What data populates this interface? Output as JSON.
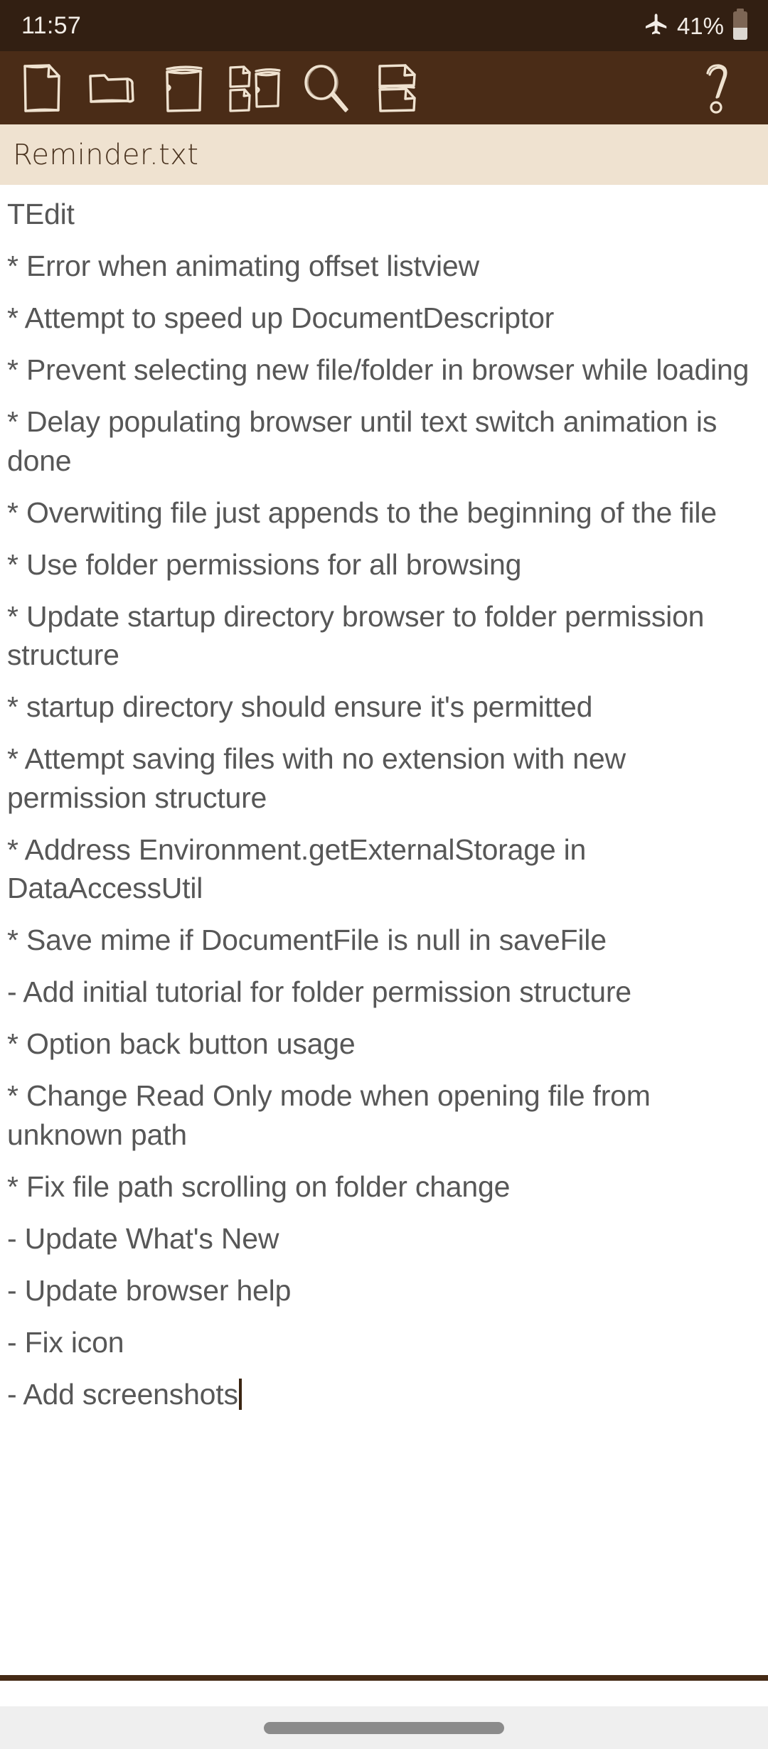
{
  "status_bar": {
    "clock": "11:57",
    "battery_percent": "41%",
    "airplane_icon": "airplane-mode-icon",
    "battery_icon": "battery-icon",
    "background_color": "#321f12",
    "foreground_color": "#f2ece6"
  },
  "toolbar": {
    "background_color": "#4a2c17",
    "icon_color": "#efe2d0",
    "items": [
      {
        "name": "new-file-icon",
        "label": "New file"
      },
      {
        "name": "open-folder-icon",
        "label": "Open folder"
      },
      {
        "name": "save-file-icon",
        "label": "Save"
      },
      {
        "name": "save-as-file-icon",
        "label": "Save as"
      },
      {
        "name": "search-icon",
        "label": "Search"
      },
      {
        "name": "split-file-icon",
        "label": "Split file"
      }
    ],
    "help": {
      "name": "help-question-icon",
      "label": "Help"
    }
  },
  "filename_bar": {
    "filename": "Reminder.txt",
    "background_color": "#efe2d0",
    "text_color": "#4a331f"
  },
  "editor": {
    "text_color": "#575757",
    "caret_color": "#3b2512",
    "underline_color": "#452a15",
    "lines": [
      "TEdit",
      "* Error when animating offset listview",
      "* Attempt to speed up DocumentDescriptor",
      "* Prevent selecting new file/folder in browser while loading",
      "* Delay populating browser until text switch animation is done",
      "* Overwiting file just appends to the beginning of the file",
      "* Use folder permissions for all browsing",
      "* Update startup directory browser to folder permission structure",
      "* startup directory should ensure it's permitted",
      "* Attempt saving files with no extension with new permission structure",
      "* Address Environment.getExternalStorage in DataAccessUtil",
      "* Save mime if DocumentFile is null in saveFile",
      "- Add initial tutorial for folder permission structure",
      "* Option back button usage",
      "* Change Read Only mode when opening file from unknown path",
      "* Fix file path scrolling on folder change",
      "- Update What's New",
      "- Update browser help",
      "- Fix icon",
      "- Add screenshots"
    ]
  },
  "nav_bar": {
    "background_color": "#efefef",
    "handle_color": "#8b8b8b",
    "handle_name": "gesture-handle"
  }
}
